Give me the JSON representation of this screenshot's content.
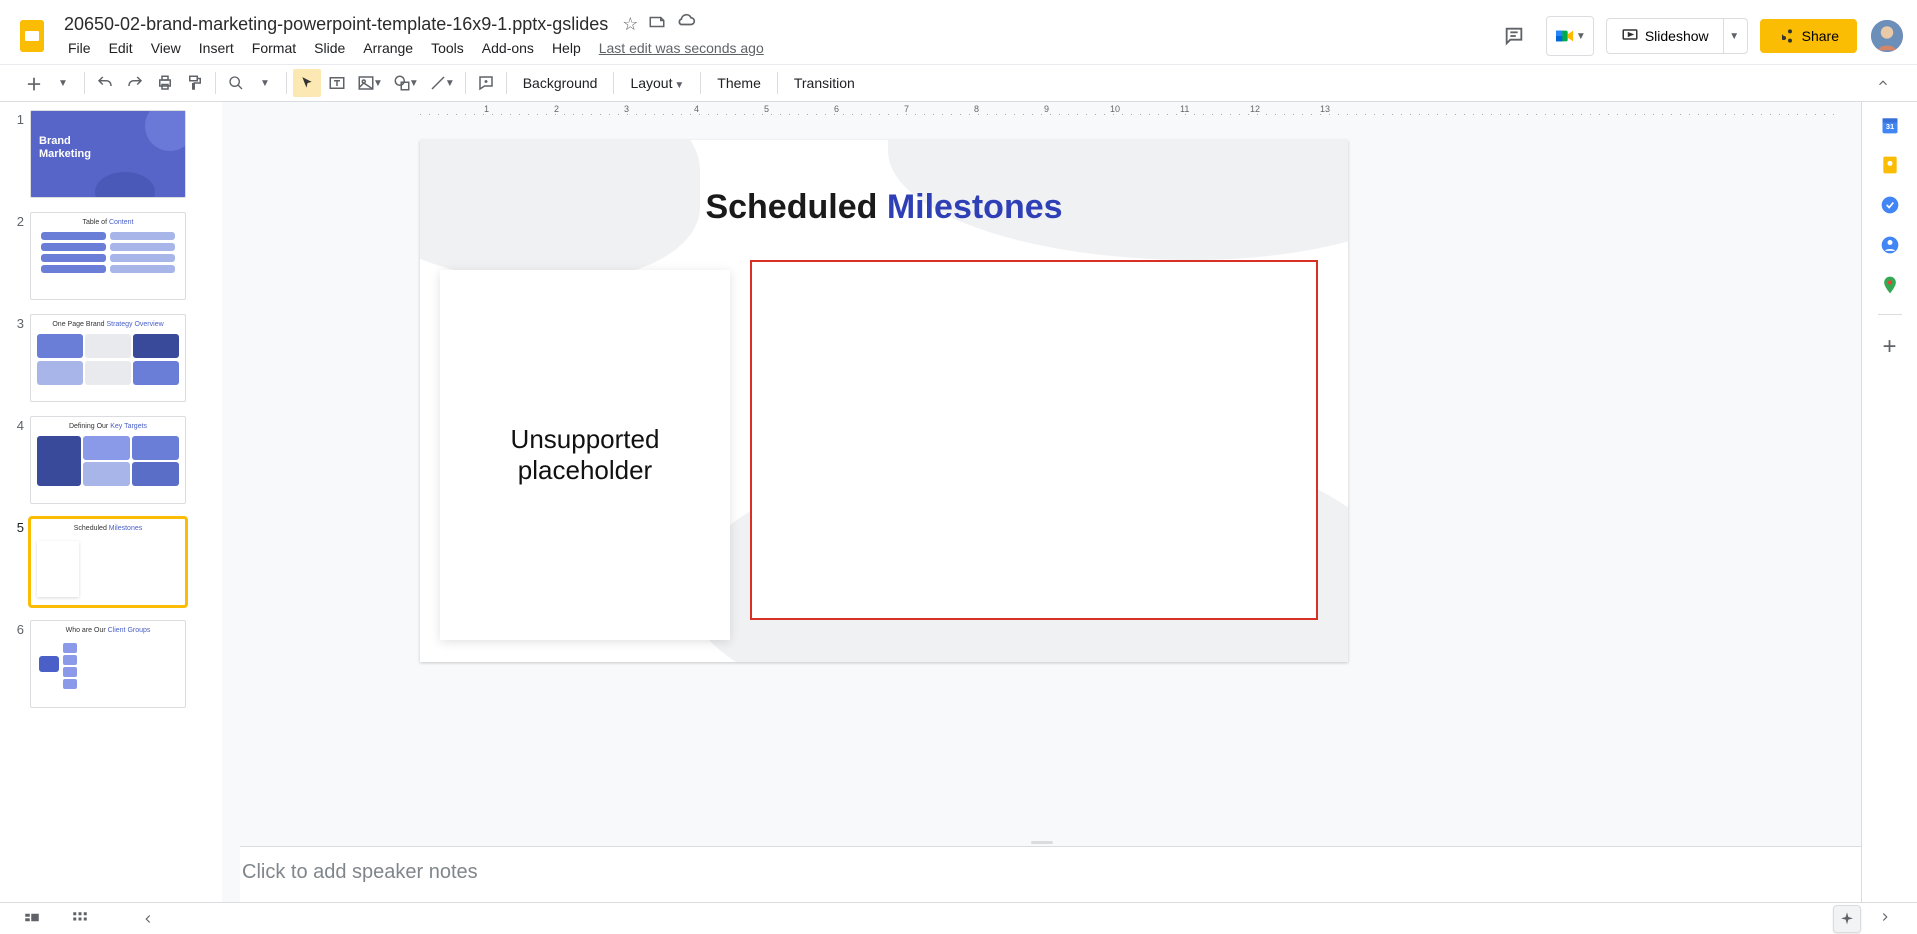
{
  "doc": {
    "title": "20650-02-brand-marketing-powerpoint-template-16x9-1.pptx-gslides",
    "last_edit": "Last edit was seconds ago"
  },
  "menus": {
    "file": "File",
    "edit": "Edit",
    "view": "View",
    "insert": "Insert",
    "format": "Format",
    "slide": "Slide",
    "arrange": "Arrange",
    "tools": "Tools",
    "addons": "Add-ons",
    "help": "Help"
  },
  "header_buttons": {
    "slideshow": "Slideshow",
    "share": "Share"
  },
  "toolbar": {
    "background": "Background",
    "layout": "Layout",
    "theme": "Theme",
    "transition": "Transition"
  },
  "filmstrip": {
    "slides": [
      {
        "num": "1",
        "title": "Brand Marketing"
      },
      {
        "num": "2",
        "title": "Table of Content"
      },
      {
        "num": "3",
        "title": "One Page Brand Strategy Overview"
      },
      {
        "num": "4",
        "title": "Defining Our Key Targets"
      },
      {
        "num": "5",
        "title": "Scheduled Milestones"
      },
      {
        "num": "6",
        "title": "Who are Our Client Groups"
      }
    ],
    "selected_index": 4
  },
  "slide": {
    "title_plain": "Scheduled ",
    "title_accent": "Milestones",
    "placeholder_text": "Unsupported placeholder"
  },
  "notes": {
    "placeholder": "Click to add speaker notes"
  },
  "ruler_numbers": [
    "1",
    "2",
    "3",
    "4",
    "5",
    "6",
    "7",
    "8",
    "9",
    "10",
    "11",
    "12",
    "13"
  ]
}
